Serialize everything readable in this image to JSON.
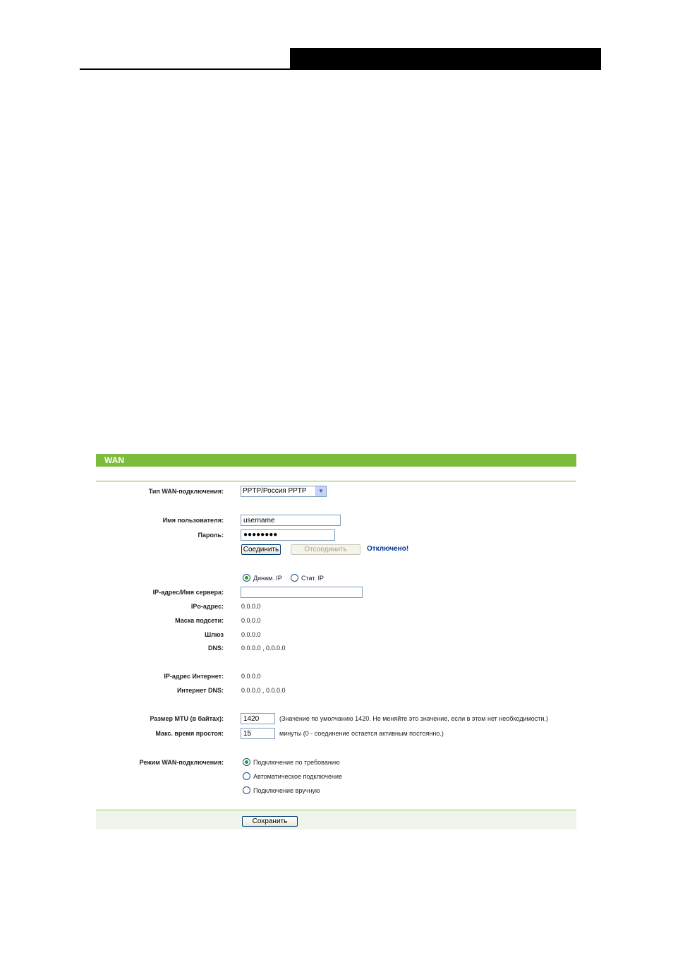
{
  "panel": {
    "title": "WAN"
  },
  "labels": {
    "wan_type": "Тип WAN-подключения:",
    "username": "Имя пользователя:",
    "password": "Пароль:",
    "server": "IP-адрес/Имя сервера:",
    "ip": "IPо-адрес:",
    "mask": "Маска подсети:",
    "gateway": "Шлюз",
    "dns": "DNS:",
    "internet_ip": "IP-адрес Интернет:",
    "internet_dns": "Интернет DNS:",
    "mtu": "Размер MTU (в байтах):",
    "idle": "Макс. время простоя:",
    "wan_mode": "Режим WAN-подключения:"
  },
  "wan_type": {
    "selected": "PPTP/Россия PPTP"
  },
  "username": {
    "value": "username"
  },
  "password": {
    "value": "●●●●●●●●"
  },
  "buttons": {
    "connect": "Соединить",
    "disconnect": "Отсоединить",
    "save": "Сохранить"
  },
  "status": "Отключено!",
  "ip_mode": {
    "dynamic": "Динам. IP",
    "static": "Стат. IP",
    "selected": "dynamic"
  },
  "server": {
    "value": ""
  },
  "values": {
    "ip": "0.0.0.0",
    "mask": "0.0.0.0",
    "gateway": "0.0.0.0",
    "dns": "0.0.0.0 , 0.0.0.0",
    "internet_ip": "0.0.0.0",
    "internet_dns": "0.0.0.0 , 0.0.0.0"
  },
  "mtu": {
    "value": "1420",
    "hint": "(Значение по умолчанию 1420. Не меняйте это значение, если в этом нет необходимости.)"
  },
  "idle": {
    "value": "15",
    "hint": "минуты (0 - соединение остается активным постоянно.)"
  },
  "wan_mode": {
    "on_demand": "Подключение по требованию",
    "auto": "Автоматическое подключение",
    "manual": "Подключение вручную",
    "selected": "on_demand"
  }
}
